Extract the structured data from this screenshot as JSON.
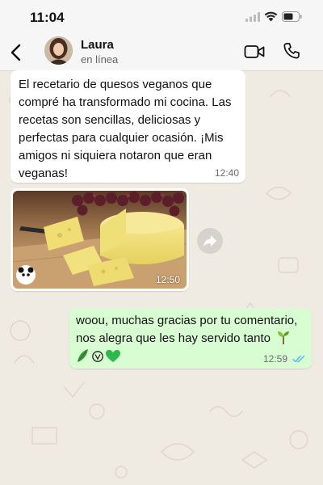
{
  "status_bar": {
    "time": "11:04"
  },
  "header": {
    "contact_name": "Laura",
    "contact_status": "en línea"
  },
  "messages": [
    {
      "direction": "incoming",
      "text": "El recetario de quesos veganos que compré ha transformado mi cocina. Las recetas son sencillas, deliciosas y perfectas para cualquier ocasión. ¡Mis amigos ni siquiera notaron que eran veganas!",
      "time": "12:40"
    },
    {
      "direction": "incoming",
      "type": "image",
      "image_description": "vegan cheese wheel and wedges on a wooden board with grapes",
      "watermark": "Life & Panda",
      "time": "12:50"
    },
    {
      "direction": "outgoing",
      "text": "woou, muchas gracias por tu comentario, nos alegra que les hay servido tanto",
      "emojis": [
        "seedling-emoji",
        "leafy-green-emoji",
        "vegan-v-emoji",
        "green-heart-emoji"
      ],
      "time": "12:59",
      "status": "read"
    }
  ],
  "colors": {
    "chat_background": "#efeae2",
    "outgoing_bubble": "#d9fdd3",
    "incoming_bubble": "#ffffff",
    "read_check": "#53bdeb"
  }
}
